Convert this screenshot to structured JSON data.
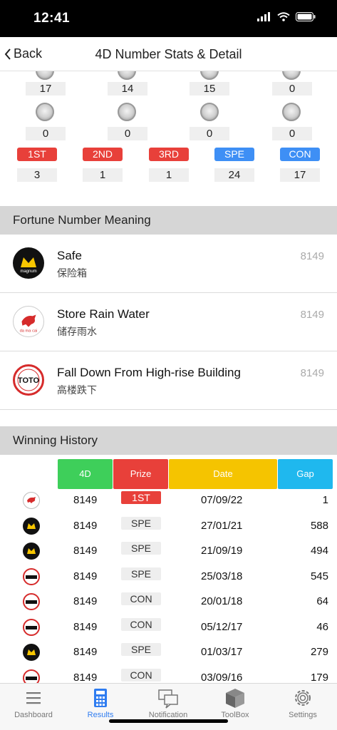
{
  "status": {
    "time": "12:41"
  },
  "nav": {
    "back_label": "Back",
    "title": "4D Number Stats & Detail"
  },
  "stats": {
    "top_counts": [
      "17",
      "14",
      "15",
      "0"
    ],
    "mid_counts": [
      "0",
      "0",
      "0",
      "0"
    ],
    "mid_icons": [
      "magnum-mini-icon",
      "damacai-mini-icon",
      "stc4d-mini-icon",
      "sabah-mini-icon"
    ],
    "prizes": [
      {
        "label": "1ST",
        "count": "3",
        "color": "#e8403a"
      },
      {
        "label": "2ND",
        "count": "1",
        "color": "#e8403a"
      },
      {
        "label": "3RD",
        "count": "1",
        "color": "#e8403a"
      },
      {
        "label": "SPE",
        "count": "24",
        "color": "#3e8ff5"
      },
      {
        "label": "CON",
        "count": "17",
        "color": "#3e8ff5"
      }
    ]
  },
  "fortune": {
    "header": "Fortune Number Meaning",
    "items": [
      {
        "logo": "magnum-logo-icon",
        "title": "Safe",
        "subtitle": "保险箱",
        "number": "8149"
      },
      {
        "logo": "damacai-logo-icon",
        "title": "Store Rain Water",
        "subtitle": "储存雨水",
        "number": "8149"
      },
      {
        "logo": "toto-logo-icon",
        "title": "Fall Down From High-rise Building",
        "subtitle": "高楼跌下",
        "number": "8149"
      }
    ]
  },
  "history": {
    "header": "Winning History",
    "columns": [
      "4D",
      "Prize",
      "Date",
      "Gap"
    ],
    "column_colors": [
      "#3ecf5a",
      "#e8403a",
      "#f5c400",
      "#1fb8ee"
    ],
    "rows": [
      {
        "logo": "damacai",
        "number": "8149",
        "prize": "1ST",
        "date": "07/09/22",
        "gap": "1"
      },
      {
        "logo": "magnum",
        "number": "8149",
        "prize": "SPE",
        "date": "27/01/21",
        "gap": "588"
      },
      {
        "logo": "magnum",
        "number": "8149",
        "prize": "SPE",
        "date": "21/09/19",
        "gap": "494"
      },
      {
        "logo": "toto",
        "number": "8149",
        "prize": "SPE",
        "date": "25/03/18",
        "gap": "545"
      },
      {
        "logo": "toto",
        "number": "8149",
        "prize": "CON",
        "date": "20/01/18",
        "gap": "64"
      },
      {
        "logo": "toto",
        "number": "8149",
        "prize": "CON",
        "date": "05/12/17",
        "gap": "46"
      },
      {
        "logo": "magnum",
        "number": "8149",
        "prize": "SPE",
        "date": "01/03/17",
        "gap": "279"
      },
      {
        "logo": "toto",
        "number": "8149",
        "prize": "CON",
        "date": "03/09/16",
        "gap": "179"
      }
    ]
  },
  "tabs": [
    {
      "label": "Dashboard",
      "icon": "dashboard-icon",
      "active": false
    },
    {
      "label": "Results",
      "icon": "calculator-icon",
      "active": true
    },
    {
      "label": "Notification",
      "icon": "notification-icon",
      "active": false
    },
    {
      "label": "ToolBox",
      "icon": "toolbox-icon",
      "active": false
    },
    {
      "label": "Settings",
      "icon": "gear-icon",
      "active": false
    }
  ],
  "colors": {
    "accent": "#2f7cf0",
    "red": "#e8403a",
    "blue": "#3e8ff5"
  }
}
